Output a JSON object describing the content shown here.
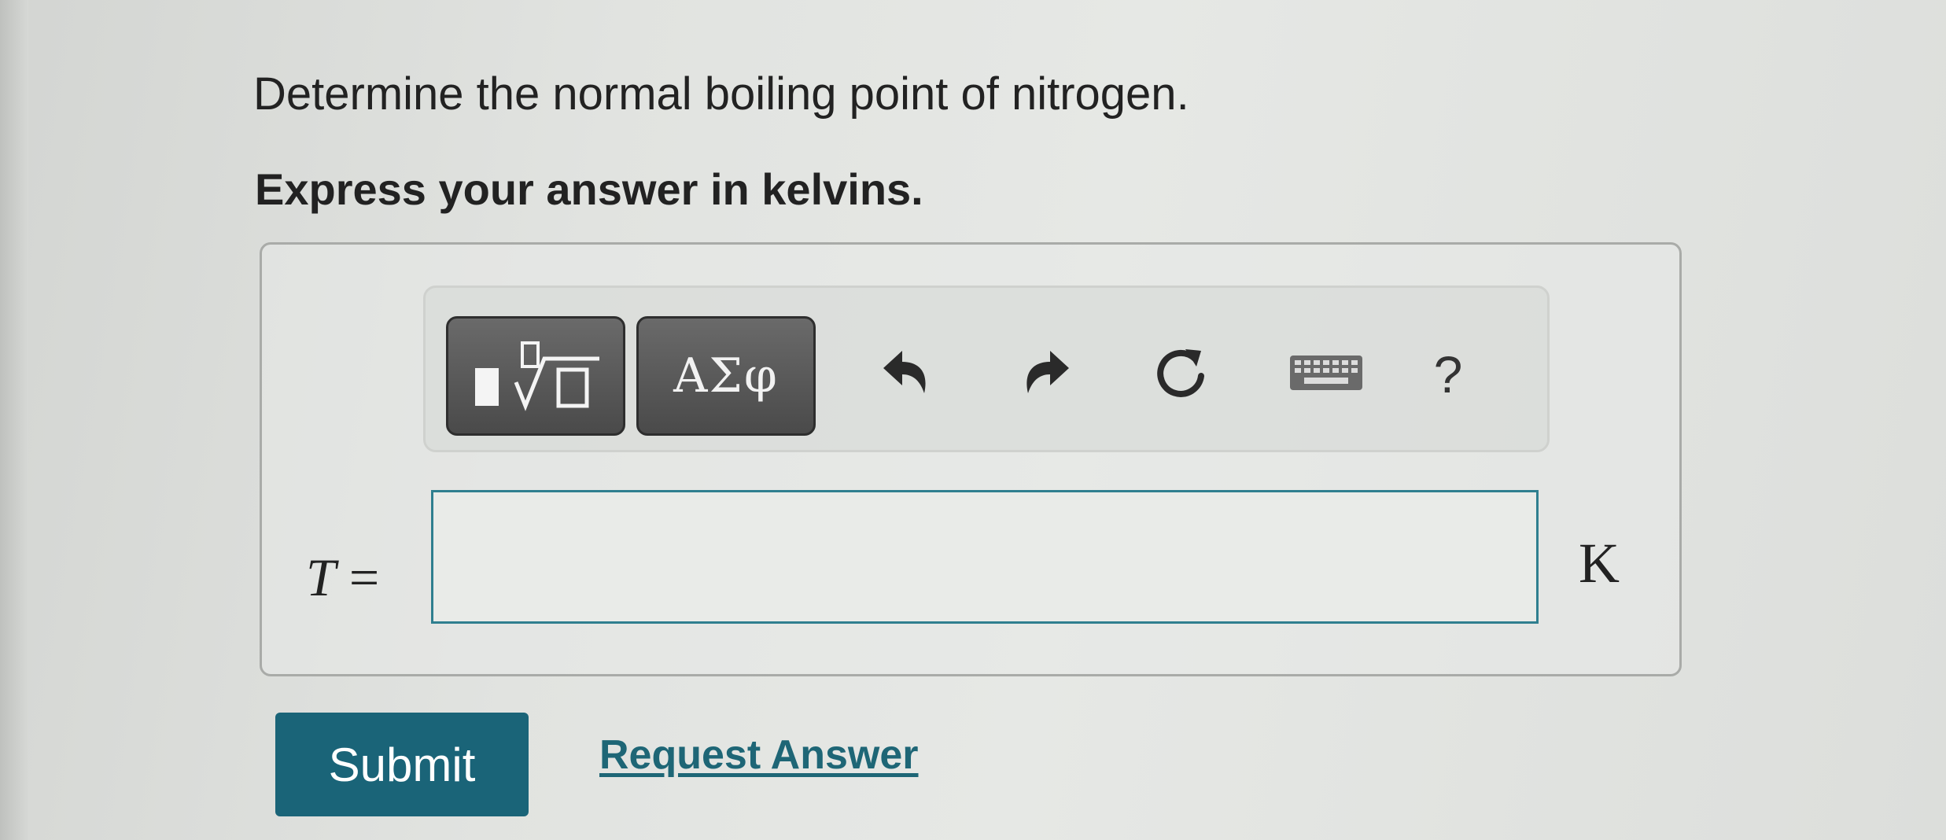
{
  "question": {
    "prompt": "Determine the normal boiling point of nitrogen.",
    "instruction": "Express your answer in kelvins."
  },
  "toolbar": {
    "templates_icon": "templates-fraction-root-icon",
    "greek_label": "ΑΣφ",
    "undo_icon": "undo-arrow-icon",
    "redo_icon": "redo-arrow-icon",
    "reset_icon": "reset-circular-arrow-icon",
    "keyboard_icon": "keyboard-icon",
    "help_label": "?"
  },
  "answer": {
    "variable": "T",
    "equals": "=",
    "value": "",
    "unit": "K"
  },
  "actions": {
    "submit_label": "Submit",
    "request_answer_label": "Request Answer"
  },
  "colors": {
    "submit_bg": "#1a6478",
    "link": "#1e6676",
    "input_border": "#2f7f8f",
    "dark_button": "#555555"
  }
}
